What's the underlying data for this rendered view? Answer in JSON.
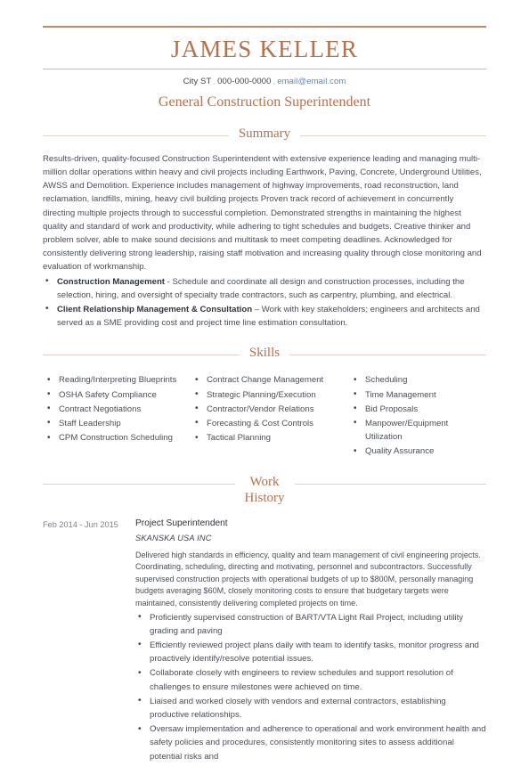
{
  "header": {
    "name": "JAMES KELLER",
    "contact": {
      "location": "City ST",
      "separator": ",",
      "phone": "000-000-0000",
      "email": "email@email.com"
    },
    "headline": "General Construction Superintendent"
  },
  "colors": {
    "accent": "#b5714d",
    "rule": "#e3d2c6",
    "top_rule": "#c08a6a",
    "body_text": "#4a4f58",
    "link": "#5b87c9"
  },
  "sections": {
    "summary": {
      "title": "Summary",
      "paragraph": "Results-driven, quality-focused Construction Superintendent with extensive experience leading and managing multi-million dollar operations within heavy and civil projects including Earthwork, Paving, Concrete, Underground Utilities, AWSS and Demolition. Experience includes management of highway improvements, road reconstruction, land reclamation, landfills, mining, heavy civil building projects Proven track record of achievement in concurrently directing multiple projects through to successful completion. Demonstrated strengths in maintaining the highest quality and standard of work and productivity, while adhering to tight schedules and budgets. Creative thinker and problem solver, able to make sound decisions and multitask to meet competing deadlines. Acknowledged for consistently delivering strong leadership, raising staff motivation and increasing quality through close monitoring and evaluation of workmanship.",
      "bullets": [
        {
          "lead": "Construction Management",
          "rest": " - Schedule and coordinate all design and construction processes, including the selection, hiring, and oversight of specialty trade contractors, such as carpentry, plumbing, and electrical."
        },
        {
          "lead": "Client Relationship Management & Consultation",
          "rest": " – Work with key stakeholders; engineers and architects and served as a SME providing cost and project time line estimation consultation."
        }
      ]
    },
    "skills": {
      "title": "Skills",
      "columns": [
        [
          "Reading/Interpreting Blueprints",
          "OSHA Safety Compliance",
          "Contract Negotiations",
          "Staff Leadership",
          "CPM Construction Scheduling"
        ],
        [
          "Contract Change Management",
          "Strategic Planning/Execution",
          "Contractor/Vendor Relations",
          "Forecasting & Cost Controls",
          "Tactical Planning"
        ],
        [
          "Scheduling",
          "Time Management",
          "Bid Proposals",
          "Manpower/Equipment Utilization",
          "Quality Assurance"
        ]
      ]
    },
    "work_history": {
      "title": "Work\nHistory",
      "jobs": [
        {
          "dates": "Feb 2014 - Jun 2015",
          "title": "Project Superintendent",
          "company": "SKANSKA USA INC",
          "description": "Delivered high standards in efficiency, quality and team management of civil engineering projects. Coordinating, scheduling, directing and motivating, personnel and subcontractors.  Successfully supervised construction projects with operational budgets of up to $800M, personally managing budgets averaging $60M, closely monitoring costs to ensure that budgetary targets were maintained, consistently delivering completed projects on time.",
          "bullets": [
            "Proficiently supervised construction of BART/VTA Light Rail Project, including utility grading and paving",
            "Efficiently reviewed project plans daily with team to identify tasks, monitor progress and proactively identify/resolve potential issues.",
            "Collaborate closely with engineers to review schedules and support resolution of challenges to ensure milestones were achieved on time.",
            "Liaised and worked closely with vendors and external contractors, establishing productive relationships.",
            "Oversaw implementation and adherence to operational and work environment health and safety policies and procedures, consistently monitoring sites to assess additional potential risks and"
          ]
        }
      ]
    }
  }
}
